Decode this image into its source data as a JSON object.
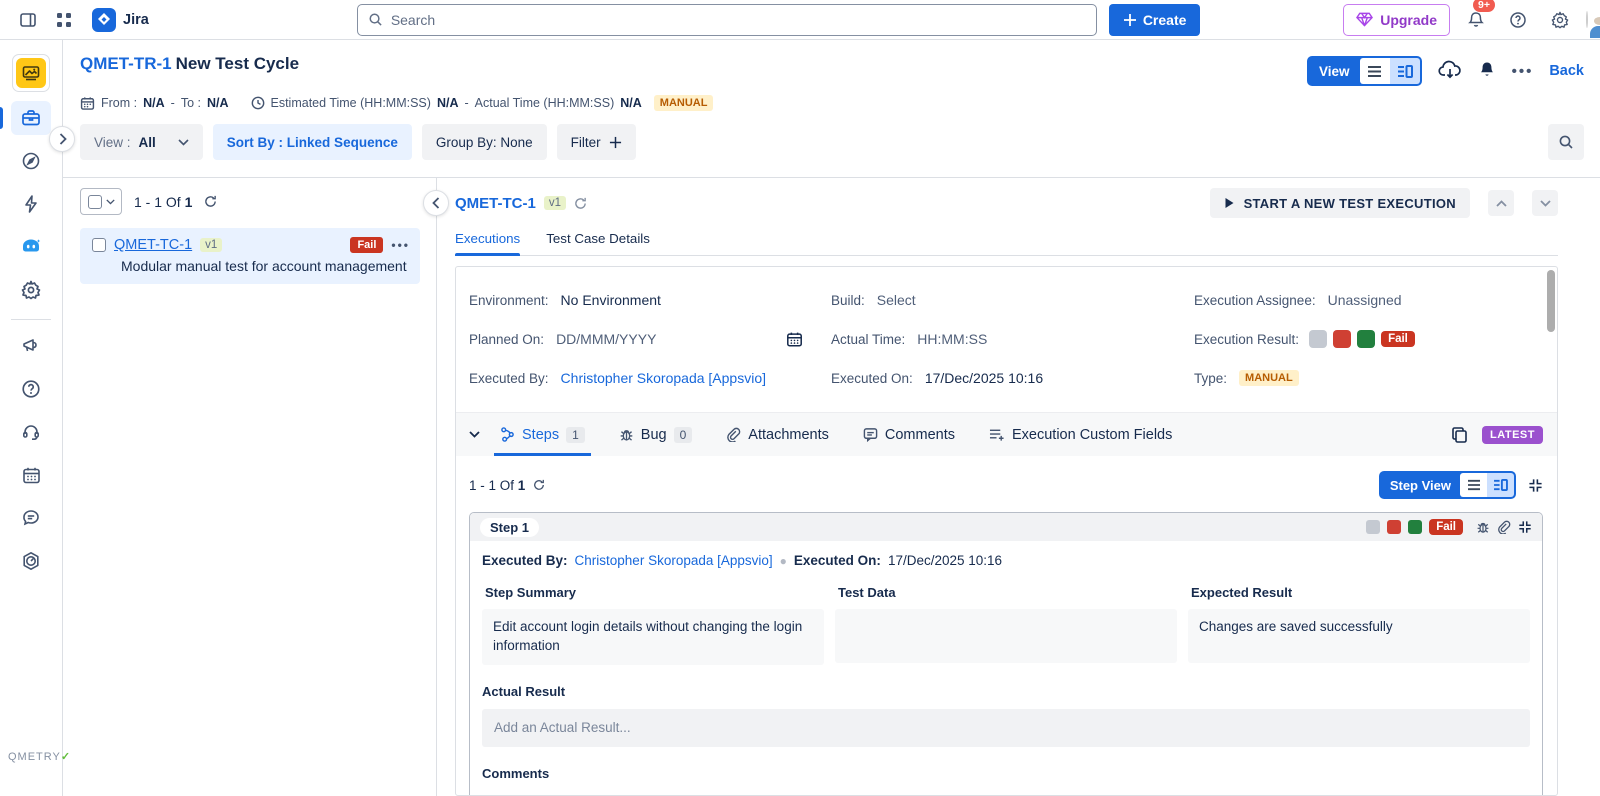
{
  "topbar": {
    "app_name": "Jira",
    "search_placeholder": "Search",
    "create_label": "Create",
    "upgrade_label": "Upgrade",
    "notification_badge": "9+"
  },
  "page": {
    "cycle_key": "QMET-TR-1",
    "cycle_title": "New Test Cycle",
    "view_button": "View",
    "back_link": "Back",
    "meta": {
      "from_label": "From :",
      "from_value": "N/A",
      "dash": "-",
      "to_label": "To :",
      "to_value": "N/A",
      "estimated_label": "Estimated Time (HH:MM:SS)",
      "estimated_value": "N/A",
      "actual_label": "Actual Time (HH:MM:SS)",
      "actual_value": "N/A",
      "type_badge": "MANUAL"
    },
    "filters": {
      "view_label": "View :",
      "view_value": "All",
      "sort_label": "Sort By : Linked Sequence",
      "group_label": "Group By: None",
      "filter_label": "Filter"
    }
  },
  "list_panel": {
    "count_text": "1 - 1 Of",
    "count_total": "1",
    "item": {
      "key": "QMET-TC-1",
      "version": "v1",
      "status": "Fail",
      "summary": "Modular manual test for account management"
    }
  },
  "detail": {
    "key": "QMET-TC-1",
    "version": "v1",
    "tabs": {
      "executions": "Executions",
      "test_case_details": "Test Case Details"
    },
    "start_button": "START A NEW TEST EXECUTION",
    "fields": {
      "environment_label": "Environment:",
      "environment_value": "No Environment",
      "build_label": "Build:",
      "build_value": "Select",
      "assignee_label": "Execution Assignee:",
      "assignee_value": "Unassigned",
      "planned_label": "Planned On:",
      "planned_value": "DD/MMM/YYYY",
      "actual_time_label": "Actual Time:",
      "actual_time_value": "HH:MM:SS",
      "result_label": "Execution Result:",
      "result_badge": "Fail",
      "executed_by_label": "Executed By:",
      "executed_by_value": "Christopher Skoropada [Appsvio]",
      "executed_on_label": "Executed On:",
      "executed_on_value": "17/Dec/2025 10:16",
      "type_label": "Type:",
      "type_value": "MANUAL"
    },
    "steps_bar": {
      "steps_label": "Steps",
      "steps_count": "1",
      "bug_label": "Bug",
      "bug_count": "0",
      "attachments_label": "Attachments",
      "comments_label": "Comments",
      "custom_fields_label": "Execution Custom Fields",
      "latest_badge": "LATEST"
    },
    "steps_toolbar": {
      "count_text": "1 - 1 Of",
      "count_total": "1",
      "step_view_label": "Step View"
    },
    "step": {
      "title": "Step 1",
      "status_badge": "Fail",
      "executed_by_label": "Executed By:",
      "executed_by_value": "Christopher Skoropada [Appsvio]",
      "executed_on_label": "Executed On:",
      "executed_on_value": "17/Dec/2025 10:16",
      "summary_header": "Step Summary",
      "summary_value": "Edit account login details without changing the login information",
      "test_data_header": "Test Data",
      "test_data_value": "",
      "expected_header": "Expected Result",
      "expected_value": "Changes are saved successfully",
      "actual_result_label": "Actual Result",
      "actual_result_placeholder": "Add an Actual Result...",
      "comments_label": "Comments"
    }
  },
  "footer": {
    "brand": "QMETRY"
  }
}
